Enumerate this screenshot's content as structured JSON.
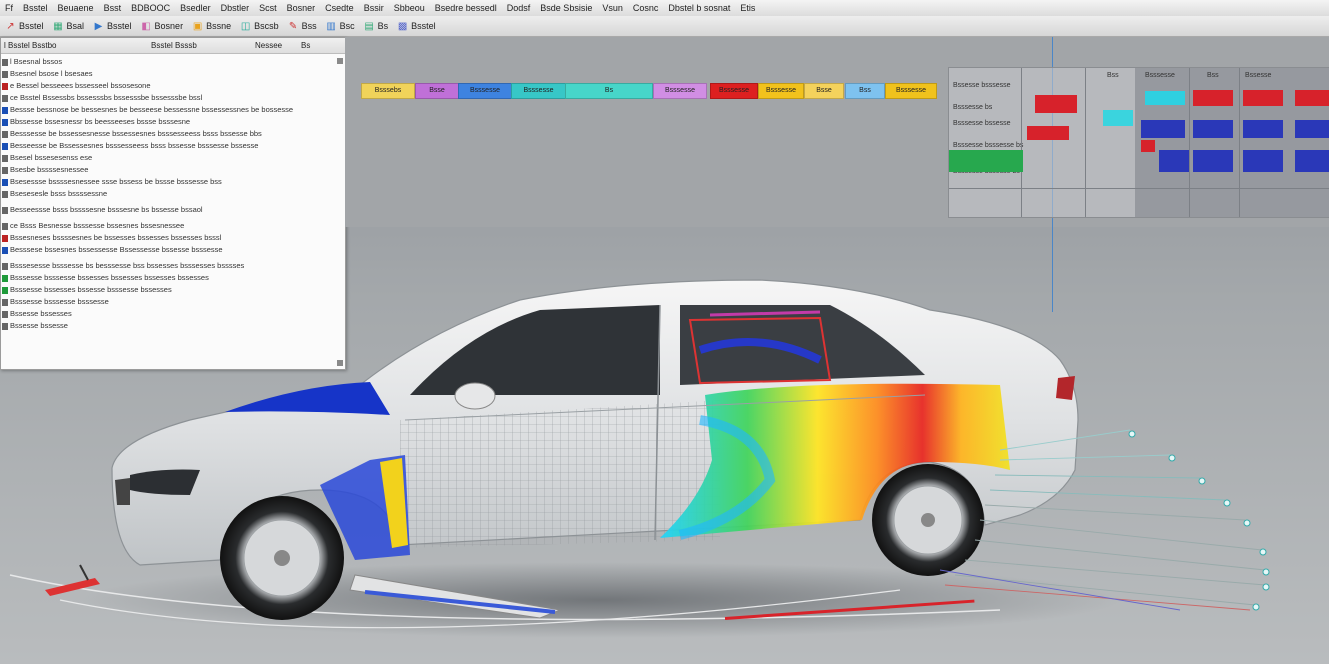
{
  "menubar": {
    "items": [
      "Ff",
      "Bsstel",
      "Beuaene",
      "Bsst",
      "BDBOOC",
      "Bsedler",
      "Dbstler",
      "Scst",
      "Bosner",
      "Csedte",
      "Bssir",
      "Sbbeou",
      "Bsedre bessedl",
      "Dodsf",
      "Bsde Sbsisie",
      "Vsun",
      "Cosnc",
      "Dbstel b sosnat",
      "Etis"
    ]
  },
  "toolbar": {
    "items": [
      {
        "icon": "arrow-icon",
        "label": "Bsstel"
      },
      {
        "icon": "grid-icon",
        "label": "Bsal"
      },
      {
        "icon": "play-icon",
        "label": "Bsstel"
      },
      {
        "icon": "layers-icon",
        "label": "Bosner"
      },
      {
        "icon": "folder-icon",
        "label": "Bssne"
      },
      {
        "icon": "mesh-icon",
        "label": "Bscsb"
      },
      {
        "icon": "pen-icon",
        "label": "Bss"
      },
      {
        "icon": "bar-chart-icon",
        "label": "Bsc"
      },
      {
        "icon": "image-icon",
        "label": "Bs"
      },
      {
        "icon": "save-icon",
        "label": "Bsstel"
      }
    ]
  },
  "panel": {
    "headers": [
      "l Bsstel Bsstbo",
      "Bsstel Bsssb",
      "Nessee",
      "Bs"
    ],
    "rows": [
      {
        "text": "l Bsesnal bssos",
        "color": "#666",
        "gap": false
      },
      {
        "text": "Bsesnel bsose l bsesaes",
        "color": "#666",
        "gap": false
      },
      {
        "text": "e Bessel besseees bssesseel bssosesone",
        "color": "#b22",
        "gap": false
      },
      {
        "text": "ce Bsstel Bssessbs bssesssbs bssesssbe bssesssbe bssl",
        "color": "#666",
        "gap": false
      },
      {
        "text": "Bessse bessnose be bessesnes be besseese bessessne bssessessnes be bossesse",
        "color": "#1a4fb5",
        "gap": false
      },
      {
        "text": "Bbssesse bssesnessr bs beesseeses bssse bsssesne",
        "color": "#1a4fb5",
        "gap": false
      },
      {
        "text": "Besssesse be bssessesnesse bssessesnes bsssesseess bsss bssesse bbs",
        "color": "#666",
        "gap": false
      },
      {
        "text": "Besseesse be Bssessesnes bsssesseess bsss bssesse bsssesse bssesse",
        "color": "#1a4fb5",
        "gap": false
      },
      {
        "text": "Bsesel bssesesenss ese",
        "color": "#666",
        "gap": false
      },
      {
        "text": "Bsesbe bssssesnessee",
        "color": "#666",
        "gap": false
      },
      {
        "text": "Bsesessse bssssesnessee ssse bssess be bssse bsssesse bss",
        "color": "#1a4fb5",
        "gap": false
      },
      {
        "text": "Bsesesesle bsss bssssessne",
        "color": "#666",
        "gap": false
      },
      {
        "text": "Besseessse bsss bssssesne bsssesne bs bssesse bssaol",
        "color": "#666",
        "gap": true
      },
      {
        "text": "ce Bsss Besnesse bsssesse bssesnes bssesnessee",
        "color": "#666",
        "gap": true
      },
      {
        "text": "Bssesneses bssssesnes be bssesses bssesses bssesses bsssl",
        "color": "#b22",
        "gap": false
      },
      {
        "text": "Besssese bssesnes bssessesse Bssessesse bssesse bsssesse",
        "color": "#1a4fb5",
        "gap": false
      },
      {
        "text": "Bsssesesse bsssesse bs besssesse bss bssesses bsssesses bsssses",
        "color": "#666",
        "gap": true
      },
      {
        "text": "Bsssesse bsssesse bssesses bssesses bssesses bssesses",
        "color": "#1f9a3a",
        "gap": false
      },
      {
        "text": "Bsssesse bssesses bssesse bsssesse bssesses",
        "color": "#1f9a3a",
        "gap": false
      },
      {
        "text": "Bsssesse bsssesse bsssesse",
        "color": "#666",
        "gap": false
      },
      {
        "text": "Bssesse bssesses",
        "color": "#666",
        "gap": false
      },
      {
        "text": "Bssesse bssesse",
        "color": "#666",
        "gap": false
      }
    ]
  },
  "viewport": {
    "label_bars": [
      {
        "text": "Bsssebs",
        "color": "#f0d35a"
      },
      {
        "text": "Bsse",
        "color": "#c070d8"
      },
      {
        "text": "Bsssesse",
        "color": "#3e83e0"
      },
      {
        "text": "Bsssesse",
        "color": "#37c7c7"
      },
      {
        "text": "Bs",
        "color": "#47d6c9"
      },
      {
        "text": "Bsssesse",
        "color": "#d18ee4"
      },
      {
        "text": "Bsssesse",
        "color": "#dd2020"
      },
      {
        "text": "Bsssesse",
        "color": "#f2c21c"
      },
      {
        "text": "Bsse",
        "color": "#f4d25c"
      },
      {
        "text": "Bss",
        "color": "#7ec2ef"
      },
      {
        "text": "Bsssesse",
        "color": "#f0c21c"
      }
    ],
    "chart_panel": {
      "headers": [
        "Bss",
        "Bsssesse",
        "Bss",
        "Bssesse"
      ],
      "row_labels": [
        "Bssesse bsssesse",
        "Bsssesse bs",
        "Bsssesse bssesse",
        "Bsssesse bsssesse bs",
        "Bsssesse bssesse bs"
      ]
    }
  },
  "colors": {
    "accent_line": "#4a86c8",
    "floor_marker": "#d8232a"
  }
}
